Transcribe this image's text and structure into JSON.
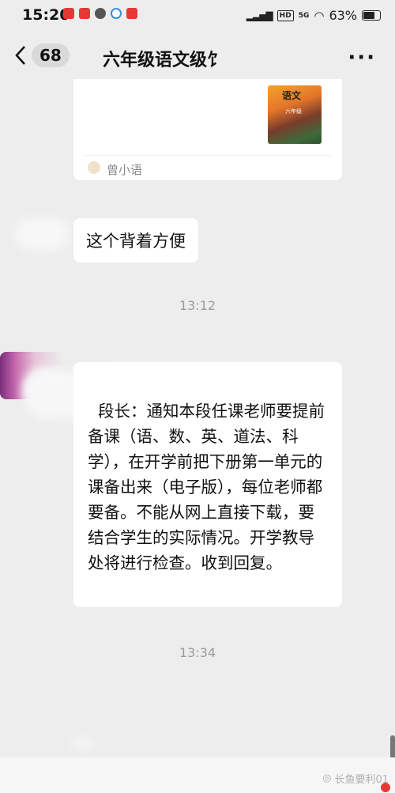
{
  "status_bar": {
    "time": "15:20",
    "network": "HD",
    "signal": "5G",
    "battery_percent": "63%",
    "battery_level": 0.63,
    "app_icon_colors": [
      "#e53935",
      "#e53935",
      "#555555",
      "#3b8fd9",
      "#e53935"
    ]
  },
  "nav": {
    "back_count": "68",
    "title": "六年级语文级饣",
    "more_icon": "···"
  },
  "card": {
    "cover_title": "语文",
    "cover_grade": "六年级",
    "source": "曾小语"
  },
  "messages": [
    {
      "text": "这个背着方便"
    },
    {
      "timestamp": "13:12"
    },
    {
      "text": "段长：通知本段任课老师要提前备课（语、数、英、道法、科学），在开学前把下册第一单元的课备出来（电子版），每位老师都要备。不能从网上直接下载，要结合学生的实际情况。开学教导处将进行检查。收到回复。"
    },
    {
      "timestamp": "13:34"
    }
  ],
  "watermark": "长鱼要利01"
}
